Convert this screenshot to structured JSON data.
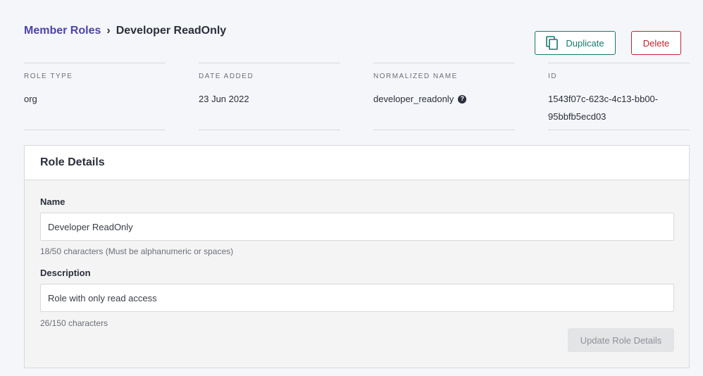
{
  "breadcrumb": {
    "parent": "Member Roles",
    "separator": "›",
    "current": "Developer ReadOnly"
  },
  "actions": {
    "duplicate_label": "Duplicate",
    "delete_label": "Delete",
    "duplicate_icon": "copy-icon"
  },
  "meta": {
    "role_type": {
      "label": "ROLE TYPE",
      "value": "org"
    },
    "date_added": {
      "label": "DATE ADDED",
      "value": "23 Jun 2022"
    },
    "normalized_name": {
      "label": "NORMALIZED NAME",
      "value": "developer_readonly",
      "help_icon": "?"
    },
    "id": {
      "label": "ID",
      "value_line1": "1543f07c-623c-4c13-bb00-",
      "value_line2": "95bbfb5ecd03"
    }
  },
  "role_details": {
    "title": "Role Details",
    "name": {
      "label": "Name",
      "value": "Developer ReadOnly",
      "hint": "18/50 characters (Must be alphanumeric or spaces)"
    },
    "description": {
      "label": "Description",
      "value": "Role with only read access",
      "hint": "26/150 characters"
    },
    "update_label": "Update Role Details"
  },
  "colors": {
    "accent": "#4c44a8",
    "duplicate": "#147a6e",
    "delete": "#c0262d"
  }
}
